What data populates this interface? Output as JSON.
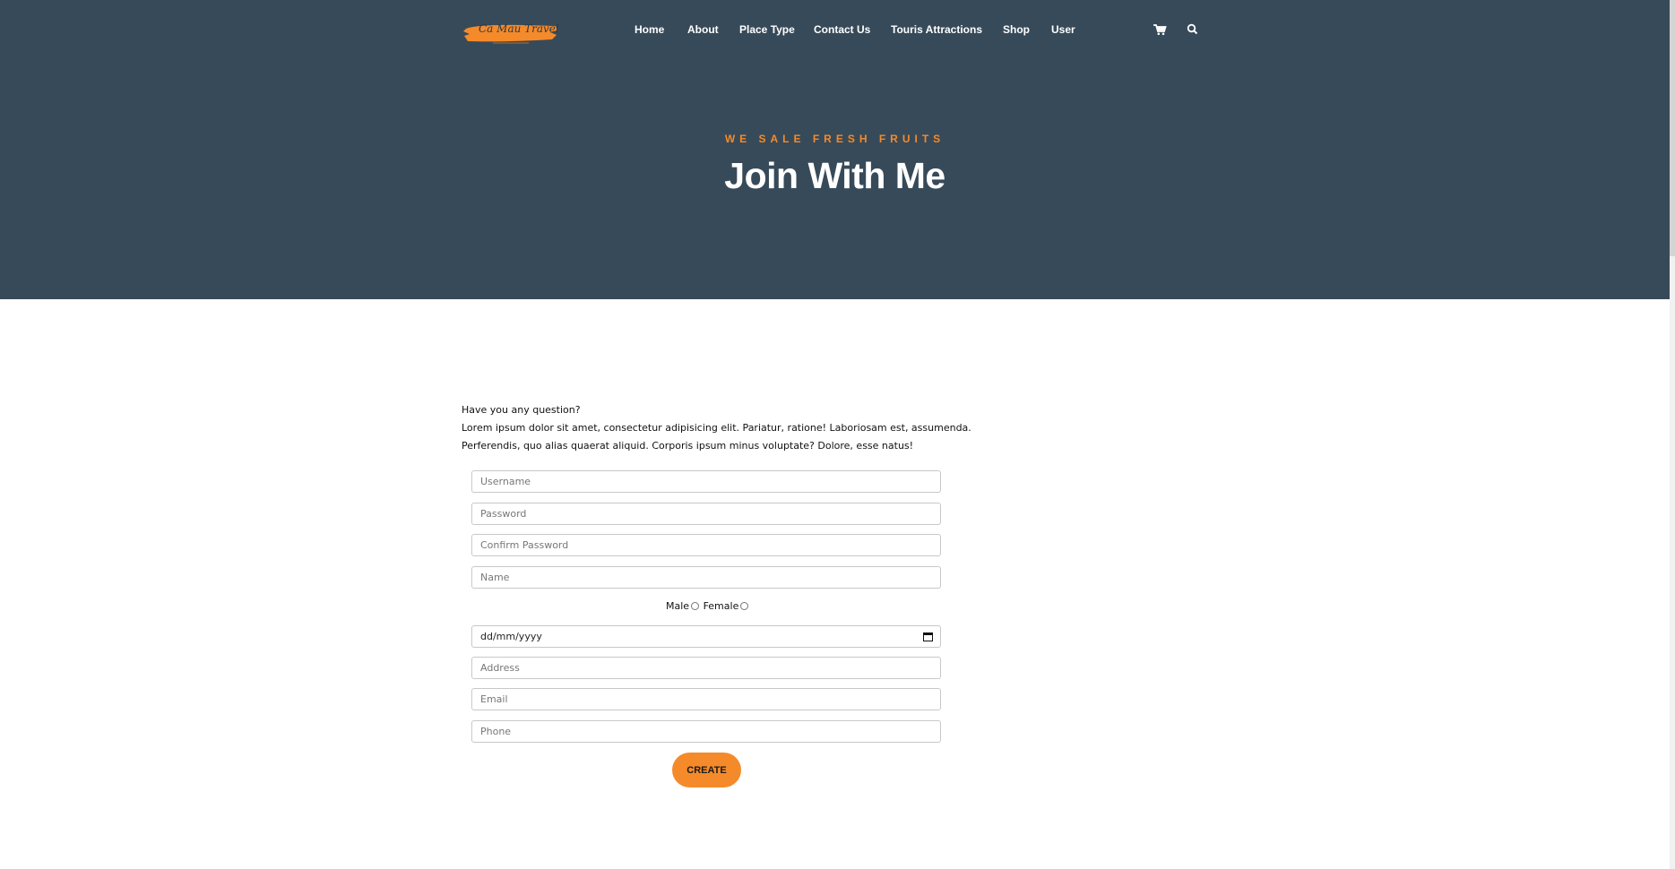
{
  "brand": {
    "logo_text": "Cà Mau Travel",
    "accent": "#f58a2a",
    "header_bg": "#374a59"
  },
  "nav": {
    "items": [
      {
        "label": "Home"
      },
      {
        "label": "About"
      },
      {
        "label": "Place Type"
      },
      {
        "label": "Contact Us"
      },
      {
        "label": "Touris Attractions"
      },
      {
        "label": "Shop"
      },
      {
        "label": "User"
      }
    ],
    "icons": [
      "shopping-cart-icon",
      "search-icon"
    ]
  },
  "hero": {
    "eyebrow": "WE SALE FRESH FRUITS",
    "title": "Join With Me"
  },
  "intro": {
    "line1": "Have you any question?",
    "line2": "Lorem ipsum dolor sit amet, consectetur adipisicing elit. Pariatur, ratione! Laboriosam est, assumenda.",
    "line3": "Perferendis, quo alias quaerat aliquid. Corporis ipsum minus voluptate? Dolore, esse natus!"
  },
  "form": {
    "username_placeholder": "Username",
    "password_placeholder": "Password",
    "confirm_password_placeholder": "Confirm Password",
    "name_placeholder": "Name",
    "gender_male_label": "Male",
    "gender_female_label": "Female",
    "date_placeholder": "dd/mm/yyyy",
    "address_placeholder": "Address",
    "email_placeholder": "Email",
    "phone_placeholder": "Phone",
    "submit_label": "CREATE"
  }
}
